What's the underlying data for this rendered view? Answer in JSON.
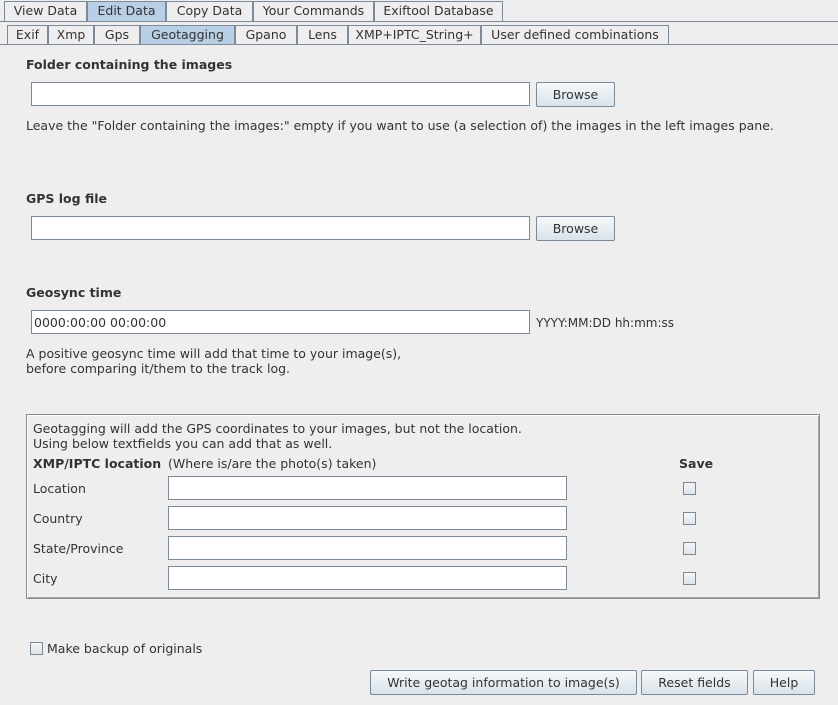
{
  "main_tabs": [
    "View Data",
    "Edit Data",
    "Copy Data",
    "Your Commands",
    "Exiftool Database"
  ],
  "sub_tabs": [
    "Exif",
    "Xmp",
    "Gps",
    "Geotagging",
    "Gpano",
    "Lens",
    "XMP+IPTC_String+",
    "User defined combinations"
  ],
  "active_main_tab": "Edit Data",
  "active_sub_tab": "Geotagging",
  "folder": {
    "heading": "Folder containing the images",
    "value": "",
    "browse_label": "Browse",
    "hint": "Leave the \"Folder containing the images:\" empty if you want to use (a selection of) the images in the left images pane."
  },
  "gps_log": {
    "heading": "GPS log file",
    "value": "",
    "browse_label": "Browse"
  },
  "geosync": {
    "heading": "Geosync time",
    "value": "0000:00:00 00:00:00",
    "format_hint": "YYYY:MM:DD hh:mm:ss",
    "note_line1": "A positive geosync time will add that time to your image(s),",
    "note_line2": "before comparing it/them to the track log."
  },
  "location_panel": {
    "info_line1": "Geotagging will add the GPS coordinates to your images, but not the location.",
    "info_line2": "Using below textfields you can add that as well.",
    "section_label": "XMP/IPTC location",
    "section_sublabel": "(Where is/are the photo(s) taken)",
    "save_header": "Save",
    "fields": [
      {
        "label": "Location",
        "value": "",
        "save": false
      },
      {
        "label": "Country",
        "value": "",
        "save": false
      },
      {
        "label": "State/Province",
        "value": "",
        "save": false
      },
      {
        "label": "City",
        "value": "",
        "save": false
      }
    ]
  },
  "backup": {
    "label": "Make backup of originals",
    "checked": false
  },
  "buttons": {
    "write": "Write geotag information to image(s)",
    "reset": "Reset fields",
    "help": "Help"
  }
}
